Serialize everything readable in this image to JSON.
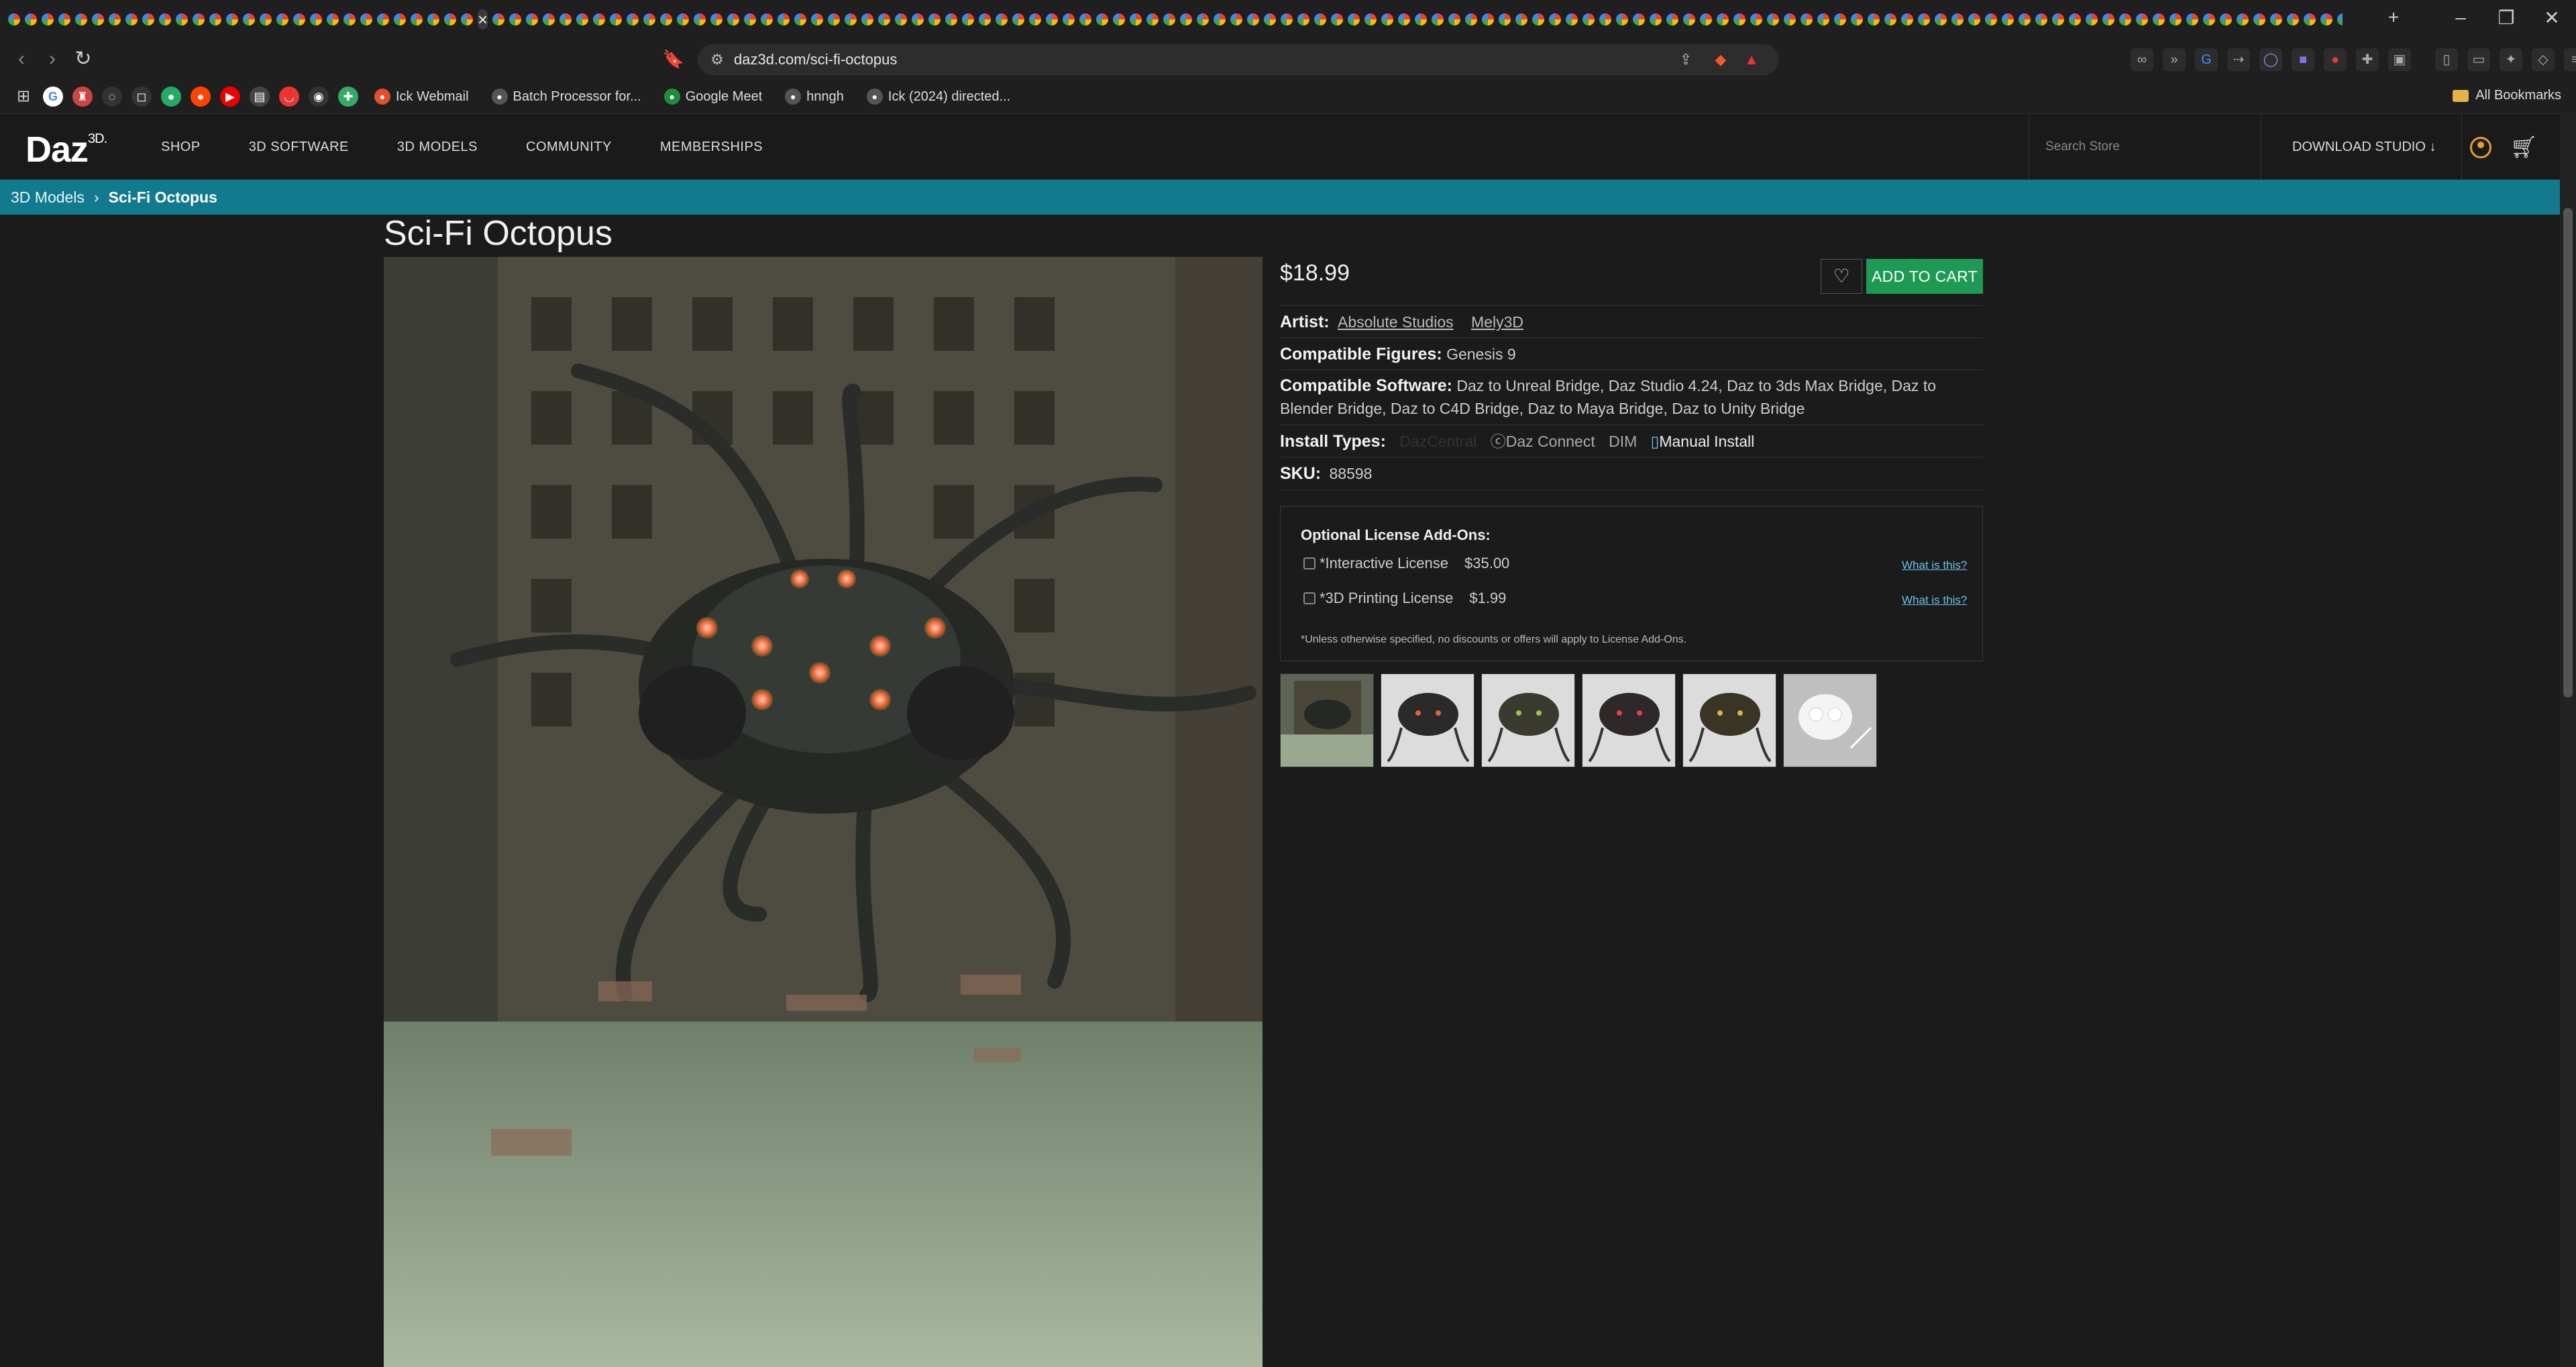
{
  "browser": {
    "active_tab_close": "×",
    "new_tab": "+",
    "window_controls": [
      "–",
      "❐",
      "✕"
    ],
    "nav": {
      "back": "‹",
      "forward": "›",
      "reload": "↻"
    },
    "url": "daz3d.com/sci-fi-octopus",
    "bookmarks": [
      {
        "label": "Ick Webmail",
        "icon": "link-icon",
        "color": "#e0502a"
      },
      {
        "label": "Batch Processor for...",
        "icon": "globe-icon",
        "color": "#555"
      },
      {
        "label": "Google Meet",
        "icon": "meet-icon",
        "color": "#1e8e3e"
      },
      {
        "label": "hnngh",
        "icon": "globe-icon",
        "color": "#555"
      },
      {
        "label": "Ick (2024) directed...",
        "icon": "globe-icon",
        "color": "#555"
      }
    ],
    "all_bookmarks": "All Bookmarks"
  },
  "site": {
    "logo": "Daz",
    "logo_sup": "3D.",
    "nav": [
      "SHOP",
      "3D SOFTWARE",
      "3D MODELS",
      "COMMUNITY",
      "MEMBERSHIPS"
    ],
    "search_placeholder": "Search Store",
    "download_studio": "DOWNLOAD STUDIO ↓"
  },
  "breadcrumb": {
    "parent": "3D Models",
    "sep": "›",
    "current": "Sci-Fi Octopus"
  },
  "product": {
    "title": "Sci-Fi Octopus",
    "price": "$18.99",
    "add_to_cart": "ADD TO CART",
    "artist_label": "Artist:",
    "artists": [
      "Absolute Studios",
      "Mely3D"
    ],
    "figures_label": "Compatible Figures:",
    "figures": "Genesis 9",
    "software_label": "Compatible Software:",
    "software": "Daz to Unreal Bridge, Daz Studio 4.24, Daz to 3ds Max Bridge, Daz to Blender Bridge, Daz to C4D Bridge, Daz to Maya Bridge, Daz to Unity Bridge",
    "install_label": "Install Types:",
    "install_types": {
      "daz_central": "DazCentral",
      "daz_connect": "Daz Connect",
      "dim": "DIM",
      "manual": "Manual Install"
    },
    "sku_label": "SKU:",
    "sku": "88598"
  },
  "license": {
    "title": "Optional License Add-Ons:",
    "items": [
      {
        "label": "*Interactive License",
        "price": "$35.00",
        "help": "What is this?"
      },
      {
        "label": "*3D Printing License",
        "price": "$1.99",
        "help": "What is this?"
      }
    ],
    "note": "*Unless otherwise specified, no discounts or offers will apply to License Add-Ons."
  },
  "colors": {
    "accent_teal": "#127a8e",
    "cart_green": "#1e9a55",
    "link_blue": "#6ac2ea"
  }
}
